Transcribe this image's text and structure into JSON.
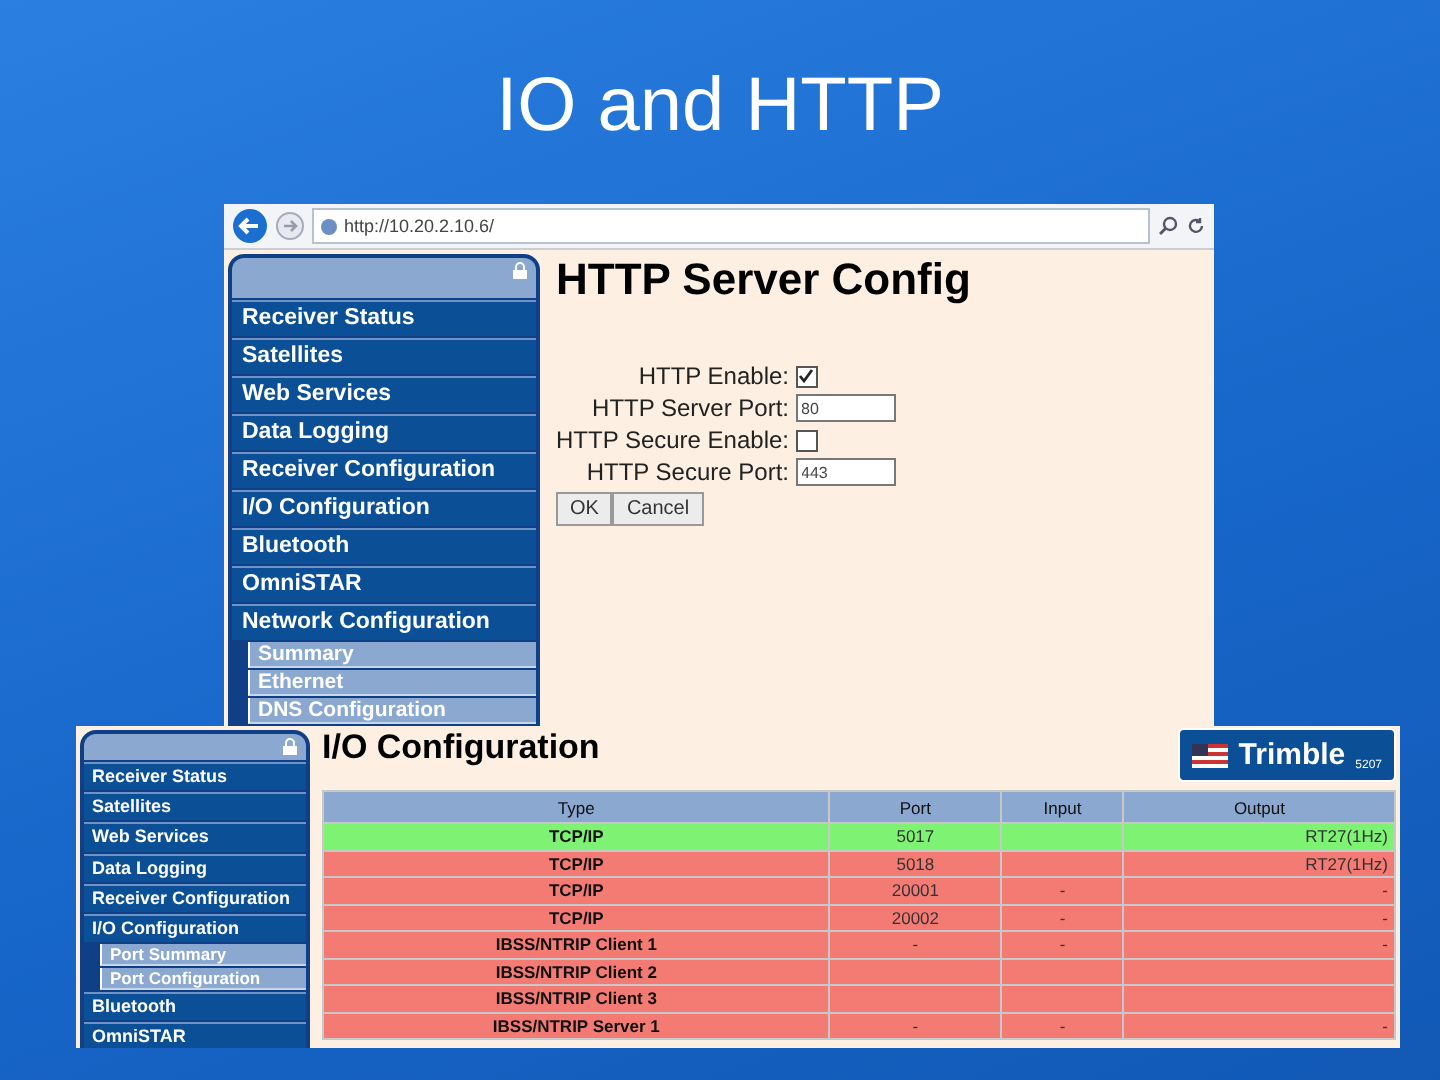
{
  "slide": {
    "title": "IO and HTTP"
  },
  "http_window": {
    "address": "http://10.20.2.10.6/",
    "nav": [
      {
        "label": "Receiver Status"
      },
      {
        "label": "Satellites"
      },
      {
        "label": "Web Services"
      },
      {
        "label": "Data Logging"
      },
      {
        "label": "Receiver Configuration"
      },
      {
        "label": "I/O Configuration"
      },
      {
        "label": "Bluetooth"
      },
      {
        "label": "OmniSTAR"
      },
      {
        "label": "Network Configuration",
        "children": [
          {
            "label": "Summary"
          },
          {
            "label": "Ethernet"
          },
          {
            "label": "DNS Configuration"
          }
        ]
      }
    ],
    "heading": "HTTP Server Config",
    "fields": [
      {
        "kind": "checkbox",
        "label": "HTTP Enable:",
        "checked": true
      },
      {
        "kind": "text",
        "label": "HTTP Server Port:",
        "value": "80"
      },
      {
        "kind": "checkbox",
        "label": "HTTP Secure Enable:",
        "checked": false
      },
      {
        "kind": "text",
        "label": "HTTP Secure Port:",
        "value": "443"
      }
    ],
    "buttons": [
      "OK",
      "Cancel"
    ]
  },
  "io_window": {
    "nav": [
      {
        "label": "Receiver Status"
      },
      {
        "label": "Satellites"
      },
      {
        "label": "Web Services"
      },
      {
        "label": "Data Logging"
      },
      {
        "label": "Receiver Configuration"
      },
      {
        "label": "I/O Configuration",
        "children": [
          {
            "label": "Port Summary"
          },
          {
            "label": "Port Configuration"
          }
        ]
      },
      {
        "label": "Bluetooth"
      },
      {
        "label": "OmniSTAR"
      }
    ],
    "heading": "I/O Configuration",
    "logo": {
      "brand": "Trimble",
      "model": "5207"
    },
    "table": {
      "columns": [
        "Type",
        "Port",
        "Input",
        "Output"
      ],
      "rows": [
        {
          "color": "#7ef272",
          "cells": [
            "TCP/IP",
            "5017",
            "",
            "RT27(1Hz)"
          ]
        },
        {
          "color": "#f47b74",
          "cells": [
            "TCP/IP",
            "5018",
            "",
            "RT27(1Hz)"
          ]
        },
        {
          "color": "#f47b74",
          "cells": [
            "TCP/IP",
            "20001",
            "-",
            "-"
          ]
        },
        {
          "color": "#f47b74",
          "cells": [
            "TCP/IP",
            "20002",
            "-",
            "-"
          ]
        },
        {
          "color": "#f47b74",
          "cells": [
            "IBSS/NTRIP Client 1",
            "-",
            "-",
            "-"
          ]
        },
        {
          "color": "#f47b74",
          "cells": [
            "IBSS/NTRIP Client 2",
            "",
            "",
            ""
          ]
        },
        {
          "color": "#f47b74",
          "cells": [
            "IBSS/NTRIP Client 3",
            "",
            "",
            ""
          ]
        },
        {
          "color": "#f47b74",
          "cells": [
            "IBSS/NTRIP Server 1",
            "-",
            "-",
            "-"
          ]
        }
      ]
    }
  }
}
